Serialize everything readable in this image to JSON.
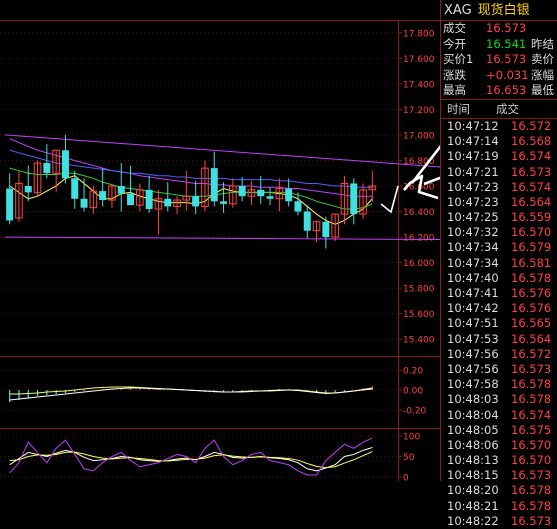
{
  "quote": {
    "symbol": "XAG",
    "name": "现货白银",
    "rows": [
      {
        "label": "成交",
        "value": "16.573",
        "value_color": "red",
        "extra": ""
      },
      {
        "label": "今开",
        "value": "16.541",
        "value_color": "grn",
        "extra": "昨结"
      },
      {
        "label": "买价1",
        "value": "16.573",
        "value_color": "red",
        "extra": "卖价"
      },
      {
        "label": "涨跌",
        "value": "+0.031",
        "value_color": "red",
        "extra": "涨幅"
      },
      {
        "label": "最高",
        "value": "16.653",
        "value_color": "red",
        "extra": "最低"
      }
    ]
  },
  "trades": {
    "headers": [
      "时间",
      "成交"
    ],
    "rows": [
      {
        "time": "10:47:12",
        "price": "16.572"
      },
      {
        "time": "10:47:14",
        "price": "16.568"
      },
      {
        "time": "10:47:19",
        "price": "16.574"
      },
      {
        "time": "10:47:21",
        "price": "16.573"
      },
      {
        "time": "10:47:23",
        "price": "16.574"
      },
      {
        "time": "10:47:23",
        "price": "16.564"
      },
      {
        "time": "10:47:25",
        "price": "16.559"
      },
      {
        "time": "10:47:32",
        "price": "16.570"
      },
      {
        "time": "10:47:34",
        "price": "16.579"
      },
      {
        "time": "10:47:34",
        "price": "16.581"
      },
      {
        "time": "10:47:40",
        "price": "16.578"
      },
      {
        "time": "10:47:41",
        "price": "16.576"
      },
      {
        "time": "10:47:42",
        "price": "16.576"
      },
      {
        "time": "10:47:51",
        "price": "16.565"
      },
      {
        "time": "10:47:53",
        "price": "16.564"
      },
      {
        "time": "10:47:56",
        "price": "16.572"
      },
      {
        "time": "10:47:56",
        "price": "16.573"
      },
      {
        "time": "10:47:58",
        "price": "16.578"
      },
      {
        "time": "10:48:03",
        "price": "16.578"
      },
      {
        "time": "10:48:04",
        "price": "16.574"
      },
      {
        "time": "10:48:05",
        "price": "16.575"
      },
      {
        "time": "10:48:06",
        "price": "16.570"
      },
      {
        "time": "10:48:13",
        "price": "16.570"
      },
      {
        "time": "10:48:15",
        "price": "16.573"
      },
      {
        "time": "10:48:20",
        "price": "16.578"
      },
      {
        "time": "10:48:21",
        "price": "16.578"
      },
      {
        "time": "10:48:22",
        "price": "16.573"
      }
    ]
  },
  "chart_data": [
    {
      "type": "candlestick",
      "yticks": [
        "17.800",
        "17.600",
        "17.400",
        "17.200",
        "17.000",
        "16.800",
        "16.600",
        "16.400",
        "16.200",
        "16.000",
        "15.800",
        "15.600",
        "15.400"
      ],
      "ylim": [
        15.3,
        17.9
      ],
      "candles": [
        {
          "o": 16.58,
          "h": 16.7,
          "l": 16.3,
          "c": 16.33
        },
        {
          "o": 16.35,
          "h": 16.72,
          "l": 16.32,
          "c": 16.62
        },
        {
          "o": 16.6,
          "h": 16.76,
          "l": 16.48,
          "c": 16.55
        },
        {
          "o": 16.55,
          "h": 16.8,
          "l": 16.52,
          "c": 16.78
        },
        {
          "o": 16.78,
          "h": 16.93,
          "l": 16.66,
          "c": 16.7
        },
        {
          "o": 16.7,
          "h": 16.88,
          "l": 16.55,
          "c": 16.88
        },
        {
          "o": 16.88,
          "h": 17.0,
          "l": 16.62,
          "c": 16.66
        },
        {
          "o": 16.66,
          "h": 16.72,
          "l": 16.42,
          "c": 16.5
        },
        {
          "o": 16.5,
          "h": 16.66,
          "l": 16.4,
          "c": 16.43
        },
        {
          "o": 16.43,
          "h": 16.6,
          "l": 16.38,
          "c": 16.56
        },
        {
          "o": 16.56,
          "h": 16.74,
          "l": 16.44,
          "c": 16.49
        },
        {
          "o": 16.49,
          "h": 16.62,
          "l": 16.43,
          "c": 16.6
        },
        {
          "o": 16.6,
          "h": 16.78,
          "l": 16.4,
          "c": 16.54
        },
        {
          "o": 16.54,
          "h": 16.76,
          "l": 16.45,
          "c": 16.45
        },
        {
          "o": 16.45,
          "h": 16.62,
          "l": 16.4,
          "c": 16.57
        },
        {
          "o": 16.57,
          "h": 16.68,
          "l": 16.39,
          "c": 16.42
        },
        {
          "o": 16.42,
          "h": 16.57,
          "l": 16.22,
          "c": 16.5
        },
        {
          "o": 16.5,
          "h": 16.63,
          "l": 16.4,
          "c": 16.44
        },
        {
          "o": 16.44,
          "h": 16.52,
          "l": 16.38,
          "c": 16.49
        },
        {
          "o": 16.49,
          "h": 16.72,
          "l": 16.41,
          "c": 16.52
        },
        {
          "o": 16.52,
          "h": 16.64,
          "l": 16.38,
          "c": 16.44
        },
        {
          "o": 16.44,
          "h": 16.8,
          "l": 16.4,
          "c": 16.74
        },
        {
          "o": 16.74,
          "h": 16.87,
          "l": 16.44,
          "c": 16.48
        },
        {
          "o": 16.48,
          "h": 16.63,
          "l": 16.39,
          "c": 16.46
        },
        {
          "o": 16.46,
          "h": 16.66,
          "l": 16.43,
          "c": 16.6
        },
        {
          "o": 16.6,
          "h": 16.67,
          "l": 16.48,
          "c": 16.52
        },
        {
          "o": 16.52,
          "h": 16.64,
          "l": 16.45,
          "c": 16.57
        },
        {
          "o": 16.57,
          "h": 16.68,
          "l": 16.46,
          "c": 16.52
        },
        {
          "o": 16.52,
          "h": 16.59,
          "l": 16.45,
          "c": 16.5
        },
        {
          "o": 16.5,
          "h": 16.66,
          "l": 16.4,
          "c": 16.58
        },
        {
          "o": 16.58,
          "h": 16.66,
          "l": 16.44,
          "c": 16.48
        },
        {
          "o": 16.48,
          "h": 16.55,
          "l": 16.37,
          "c": 16.4
        },
        {
          "o": 16.4,
          "h": 16.45,
          "l": 16.19,
          "c": 16.25
        },
        {
          "o": 16.25,
          "h": 16.33,
          "l": 16.16,
          "c": 16.32
        },
        {
          "o": 16.32,
          "h": 16.36,
          "l": 16.11,
          "c": 16.2
        },
        {
          "o": 16.2,
          "h": 16.38,
          "l": 16.17,
          "c": 16.38
        },
        {
          "o": 16.38,
          "h": 16.68,
          "l": 16.3,
          "c": 16.62
        },
        {
          "o": 16.62,
          "h": 16.66,
          "l": 16.3,
          "c": 16.38
        },
        {
          "o": 16.38,
          "h": 16.62,
          "l": 16.34,
          "c": 16.57
        },
        {
          "o": 16.57,
          "h": 16.72,
          "l": 16.48,
          "c": 16.6
        }
      ],
      "ma_series": [
        {
          "color": "#ffff55",
          "values": [
            16.6,
            16.55,
            16.5,
            16.52,
            16.56,
            16.6,
            16.66,
            16.68,
            16.62,
            16.56,
            16.5,
            16.5,
            16.54,
            16.55,
            16.52,
            16.5,
            16.48,
            16.47,
            16.47,
            16.47,
            16.46,
            16.48,
            16.54,
            16.58,
            16.56,
            16.55,
            16.55,
            16.55,
            16.55,
            16.54,
            16.53,
            16.5,
            16.44,
            16.38,
            16.33,
            16.3,
            16.33,
            16.38,
            16.42,
            16.5
          ]
        },
        {
          "color": "#30d030",
          "values": [
            16.74,
            16.72,
            16.7,
            16.69,
            16.69,
            16.69,
            16.7,
            16.7,
            16.68,
            16.66,
            16.63,
            16.61,
            16.59,
            16.58,
            16.57,
            16.56,
            16.55,
            16.54,
            16.53,
            16.52,
            16.52,
            16.52,
            16.53,
            16.54,
            16.55,
            16.55,
            16.55,
            16.55,
            16.55,
            16.55,
            16.55,
            16.53,
            16.51,
            16.48,
            16.46,
            16.44,
            16.42,
            16.42,
            16.43,
            16.46
          ]
        },
        {
          "color": "#c040ff",
          "values": [
            16.97,
            16.94,
            16.91,
            16.88,
            16.86,
            16.84,
            16.82,
            16.8,
            16.78,
            16.76,
            16.74,
            16.72,
            16.71,
            16.7,
            16.68,
            16.67,
            16.66,
            16.65,
            16.64,
            16.63,
            16.62,
            16.62,
            16.61,
            16.61,
            16.6,
            16.6,
            16.6,
            16.59,
            16.59,
            16.59,
            16.58,
            16.58,
            16.57,
            16.56,
            16.55,
            16.54,
            16.53,
            16.52,
            16.52,
            16.52
          ]
        },
        {
          "color": "#5060ff",
          "values": [
            16.88,
            16.86,
            16.84,
            16.82,
            16.8,
            16.78,
            16.77,
            16.76,
            16.75,
            16.74,
            16.73,
            16.72,
            16.71,
            16.7,
            16.7,
            16.69,
            16.68,
            16.68,
            16.67,
            16.67,
            16.66,
            16.66,
            16.66,
            16.66,
            16.65,
            16.65,
            16.65,
            16.65,
            16.65,
            16.64,
            16.64,
            16.63,
            16.62,
            16.62,
            16.61,
            16.6,
            16.6,
            16.59,
            16.59,
            16.59
          ]
        }
      ],
      "trendlines": [
        {
          "color": "#c040ff",
          "from": [
            0,
            17.0
          ],
          "to": [
            48,
            16.74
          ]
        },
        {
          "color": "#c040ff",
          "from": [
            0,
            16.2
          ],
          "to": [
            48,
            16.18
          ]
        }
      ]
    },
    {
      "type": "bar",
      "yticks": [
        "0.20",
        "0.00",
        "-0.20"
      ],
      "ylim": [
        -0.3,
        0.3
      ],
      "values": [
        -0.12,
        -0.1,
        -0.08,
        -0.06,
        -0.05,
        -0.04,
        -0.03,
        -0.02,
        -0.01,
        0.0,
        0.01,
        0.015,
        0.02,
        0.025,
        0.02,
        0.015,
        0.01,
        0.01,
        0.005,
        0.0,
        -0.01,
        -0.02,
        -0.025,
        -0.02,
        -0.015,
        -0.01,
        -0.005,
        0.0,
        0.005,
        0.01,
        0.01,
        0.0,
        -0.02,
        -0.03,
        -0.04,
        -0.03,
        -0.02,
        0.0,
        0.02,
        0.04
      ],
      "lines": [
        {
          "color": "#ffff55",
          "values": [
            -0.04,
            -0.04,
            -0.035,
            -0.03,
            -0.02,
            -0.015,
            -0.01,
            0,
            0.01,
            0.02,
            0.025,
            0.03,
            0.03,
            0.03,
            0.025,
            0.02,
            0.015,
            0.01,
            0.005,
            0,
            -0.005,
            -0.01,
            -0.015,
            -0.02,
            -0.02,
            -0.02,
            -0.015,
            -0.01,
            -0.01,
            -0.005,
            0,
            0,
            -0.01,
            -0.02,
            -0.03,
            -0.03,
            -0.02,
            -0.01,
            0,
            0.01
          ]
        },
        {
          "color": "#ffffff",
          "values": [
            -0.1,
            -0.09,
            -0.08,
            -0.07,
            -0.06,
            -0.05,
            -0.04,
            -0.03,
            -0.02,
            -0.01,
            0.0,
            0.01,
            0.015,
            0.02,
            0.02,
            0.015,
            0.01,
            0.01,
            0.005,
            0.0,
            -0.005,
            -0.01,
            -0.015,
            -0.02,
            -0.02,
            -0.015,
            -0.01,
            -0.01,
            -0.005,
            0.0,
            0.0,
            -0.005,
            -0.015,
            -0.025,
            -0.035,
            -0.03,
            -0.02,
            -0.01,
            0.005,
            0.02
          ]
        }
      ]
    },
    {
      "type": "line",
      "yticks": [
        "100",
        "50",
        "0"
      ],
      "ylim": [
        0,
        100
      ],
      "series": [
        {
          "color": "#ffffff",
          "values": [
            30,
            45,
            60,
            55,
            50,
            58,
            65,
            60,
            48,
            40,
            42,
            45,
            50,
            48,
            42,
            40,
            38,
            40,
            44,
            46,
            42,
            50,
            60,
            55,
            48,
            46,
            48,
            50,
            47,
            45,
            42,
            35,
            20,
            15,
            22,
            30,
            50,
            55,
            65,
            72
          ]
        },
        {
          "color": "#ffff55",
          "values": [
            40,
            42,
            50,
            54,
            53,
            55,
            60,
            61,
            56,
            50,
            46,
            44,
            46,
            47,
            45,
            43,
            40,
            39,
            41,
            43,
            43,
            46,
            52,
            54,
            51,
            49,
            48,
            49,
            48,
            47,
            45,
            41,
            33,
            26,
            23,
            25,
            34,
            42,
            52,
            62
          ]
        },
        {
          "color": "#c040ff",
          "values": [
            10,
            35,
            85,
            60,
            35,
            70,
            90,
            55,
            20,
            15,
            35,
            50,
            60,
            40,
            25,
            30,
            35,
            45,
            55,
            50,
            35,
            70,
            90,
            50,
            30,
            40,
            55,
            60,
            40,
            35,
            30,
            15,
            5,
            5,
            40,
            60,
            80,
            70,
            85,
            95
          ]
        }
      ]
    }
  ]
}
